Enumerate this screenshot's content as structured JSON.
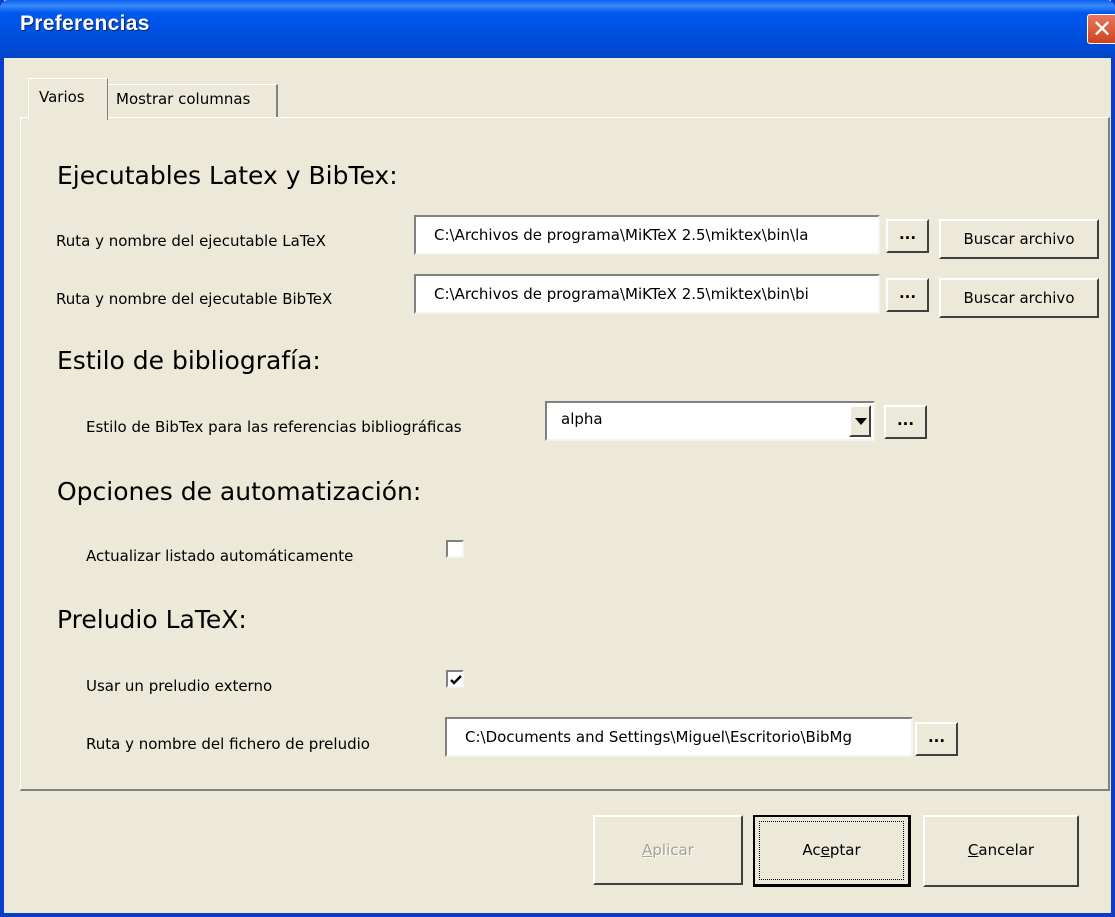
{
  "window": {
    "title": "Preferencias"
  },
  "tabs": [
    {
      "label": "Varios",
      "active": true
    },
    {
      "label": "Mostrar columnas",
      "active": false
    }
  ],
  "sections": {
    "executables": {
      "heading": "Ejecutables Latex y BibTex:",
      "latex": {
        "label": "Ruta y nombre del ejecutable LaTeX",
        "value": "C:\\Archivos de programa\\MiKTeX 2.5\\miktex\\bin\\la",
        "dots_label": "...",
        "browse_label": "Buscar archivo"
      },
      "bibtex": {
        "label": "Ruta y nombre del ejecutable BibTeX",
        "value": "C:\\Archivos de programa\\MiKTeX 2.5\\miktex\\bin\\bi",
        "dots_label": "...",
        "browse_label": "Buscar archivo"
      }
    },
    "bibliography": {
      "heading": "Estilo de bibliografía:",
      "style_label": "Estilo de BibTex para las referencias bibliográficas",
      "style_value": "alpha",
      "dots_label": "..."
    },
    "automation": {
      "heading": "Opciones de automatización:",
      "auto_update_label": "Actualizar listado automáticamente",
      "auto_update_checked": false
    },
    "prelude": {
      "heading": "Preludio LaTeX:",
      "external_label": "Usar un preludio externo",
      "external_checked": true,
      "file_label": "Ruta y nombre del fichero de preludio",
      "file_value": "C:\\Documents and Settings\\Miguel\\Escritorio\\BibMg",
      "dots_label": "..."
    }
  },
  "footer": {
    "apply": {
      "prefix": "",
      "mnemonic": "A",
      "suffix": "plicar",
      "enabled": false
    },
    "ok": {
      "prefix": "Ac",
      "mnemonic": "e",
      "suffix": "ptar",
      "enabled": true
    },
    "cancel": {
      "prefix": "",
      "mnemonic": "C",
      "suffix": "ancelar",
      "enabled": true
    }
  },
  "colors": {
    "titlebar": "#0058ee",
    "face": "#ece9d8",
    "close": "#d1421c"
  },
  "icons": {
    "close": "close-icon",
    "dropdown": "chevron-down-icon",
    "check": "checkmark-icon"
  }
}
